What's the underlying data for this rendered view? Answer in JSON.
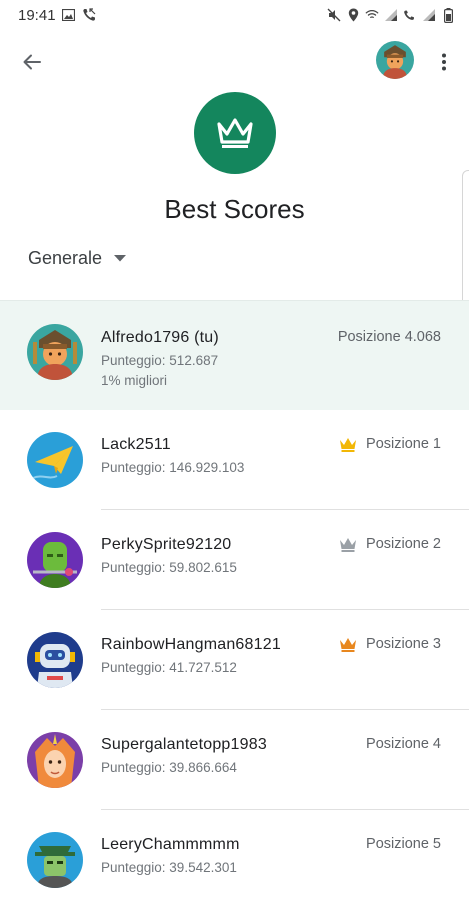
{
  "status_bar": {
    "time": "19:41"
  },
  "app_bar": {
    "back_icon": "arrow-back-icon",
    "more_icon": "more-vert-icon"
  },
  "header": {
    "title": "Best Scores",
    "icon": "crown-icon",
    "icon_color": "#14865d"
  },
  "filter": {
    "label": "Generale",
    "icon": "dropdown-arrow-icon"
  },
  "current_player": {
    "name": "Alfredo1796 (tu)",
    "score": "Punteggio: 512.687",
    "percentile": "1% migliori",
    "rank": "Posizione 4.068"
  },
  "players": [
    {
      "name": "Lack2511",
      "score": "Punteggio: 146.929.103",
      "rank": "Posizione 1",
      "crown": "gold",
      "crown_color": "#f2b705"
    },
    {
      "name": "PerkySprite92120",
      "score": "Punteggio: 59.802.615",
      "rank": "Posizione 2",
      "crown": "silver",
      "crown_color": "#9aa0a6"
    },
    {
      "name": "RainbowHangman68121",
      "score": "Punteggio: 41.727.512",
      "rank": "Posizione 3",
      "crown": "bronze",
      "crown_color": "#e8871e"
    },
    {
      "name": "Supergalantetopp1983",
      "score": "Punteggio: 39.866.664",
      "rank": "Posizione 4"
    },
    {
      "name": "LeeryChammmmm",
      "score": "Punteggio: 39.542.301",
      "rank": "Posizione 5"
    }
  ],
  "colors": {
    "accent": "#14865d",
    "highlight_row": "#eef6f3"
  }
}
